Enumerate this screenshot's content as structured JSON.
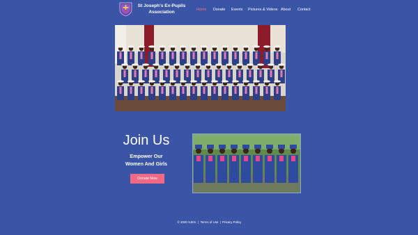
{
  "header": {
    "logo_icon": "school-crest-icon",
    "title_line1": "St Joseph's Ex-Pupils",
    "title_line2": "Association"
  },
  "nav": {
    "items": [
      {
        "label": "Home",
        "active": true
      },
      {
        "label": "Donate",
        "active": false
      },
      {
        "label": "Events",
        "active": false
      },
      {
        "label": "Pictures & Videos",
        "active": false
      },
      {
        "label": "About",
        "active": false
      },
      {
        "label": "Contact",
        "active": false
      }
    ]
  },
  "join": {
    "title": "Join Us",
    "subtitle_line1": "Empower Our",
    "subtitle_line2": "Women And Girls",
    "button_label": "Donate Now"
  },
  "footer": {
    "copyright": "© 2020 SJES",
    "sep1": "|",
    "terms": "Terms of Use",
    "sep2": "|",
    "privacy": "Privacy Policy"
  },
  "colors": {
    "background": "#3a55a6",
    "accent": "#f06a86",
    "nav_active": "#f27089",
    "text": "#ffffff"
  }
}
